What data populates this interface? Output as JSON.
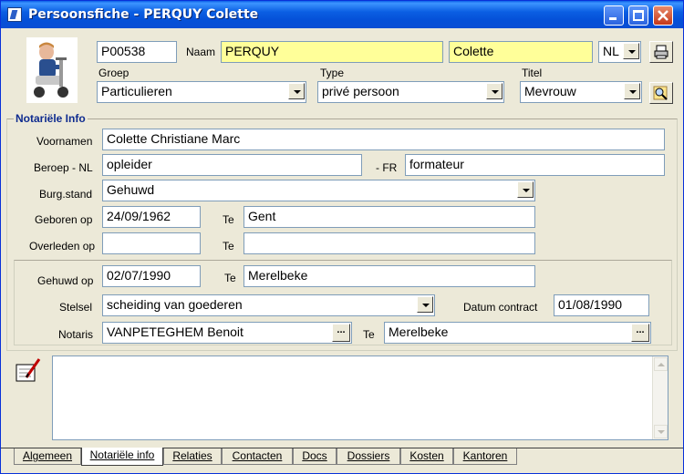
{
  "window": {
    "title": "Persoonsfiche - PERQUY Colette"
  },
  "header": {
    "id_value": "P00538",
    "naam_label": "Naam",
    "lastname_value": "PERQUY",
    "firstname_value": "Colette",
    "language_value": "NL",
    "groep_label": "Groep",
    "groep_value": "Particulieren",
    "type_label": "Type",
    "type_value": "privé persoon",
    "titel_label": "Titel",
    "titel_value": "Mevrouw"
  },
  "notarial": {
    "section_title": "Notariële Info",
    "voornamen_label": "Voornamen",
    "voornamen_value": "Colette Christiane Marc",
    "beroep_nl_label": "Beroep - NL",
    "beroep_nl_value": "opleider",
    "beroep_fr_label": "- FR",
    "beroep_fr_value": "formateur",
    "burgstand_label": "Burg.stand",
    "burgstand_value": "Gehuwd",
    "geboren_label": "Geboren op",
    "geboren_value": "24/09/1962",
    "geboren_te_label": "Te",
    "geboren_te_value": "Gent",
    "overleden_label": "Overleden op",
    "overleden_value": "",
    "overleden_te_label": "Te",
    "overleden_te_value": ""
  },
  "marriage": {
    "gehuwd_label": "Gehuwd op",
    "gehuwd_value": "02/07/1990",
    "gehuwd_te_label": "Te",
    "gehuwd_te_value": "Merelbeke",
    "stelsel_label": "Stelsel",
    "stelsel_value": "scheiding van goederen",
    "datum_contract_label": "Datum contract",
    "datum_contract_value": "01/08/1990",
    "notaris_label": "Notaris",
    "notaris_value": "VANPETEGHEM Benoit",
    "notaris_te_label": "Te",
    "notaris_te_value": "Merelbeke",
    "dots_label": "..."
  },
  "memo": {
    "value": ""
  },
  "tabs": [
    {
      "label": "Algemeen"
    },
    {
      "label": "Notariële info"
    },
    {
      "label": "Relaties"
    },
    {
      "label": "Contacten"
    },
    {
      "label": "Docs"
    },
    {
      "label": "Dossiers"
    },
    {
      "label": "Kosten"
    },
    {
      "label": "Kantoren"
    }
  ],
  "icons": {
    "app": "app-icon",
    "print": "printer-icon",
    "search": "magnifier-icon",
    "note": "note-pen-icon",
    "photo": "person-photo"
  },
  "colors": {
    "titlebar": "#0550d8",
    "highlight": "#ffff99",
    "section_title": "#0e2b8f"
  }
}
